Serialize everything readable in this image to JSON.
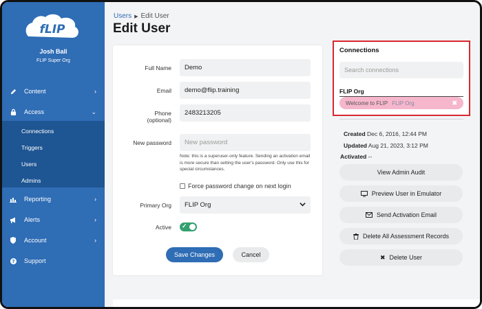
{
  "sidebar": {
    "user_name": "Josh Ball",
    "user_org": "FLIP Super Org",
    "items": [
      {
        "label": "Content",
        "icon": "pencil-icon"
      },
      {
        "label": "Access",
        "icon": "lock-icon"
      },
      {
        "label": "Reporting",
        "icon": "bar-chart-icon"
      },
      {
        "label": "Alerts",
        "icon": "megaphone-icon"
      },
      {
        "label": "Account",
        "icon": "shield-icon"
      },
      {
        "label": "Support",
        "icon": "help-circle-icon"
      }
    ],
    "access_submenu": [
      "Connections",
      "Triggers",
      "Users",
      "Admins"
    ]
  },
  "breadcrumb": {
    "parent": "Users",
    "current": "Edit User"
  },
  "page_title": "Edit User",
  "form": {
    "full_name_label": "Full Name",
    "full_name_value": "Demo",
    "email_label": "Email",
    "email_value": "demo@flip.training",
    "phone_label_1": "Phone",
    "phone_label_2": "(optional)",
    "phone_value": "2483213205",
    "password_label": "New password",
    "password_placeholder": "New password",
    "password_note": "Note: this is a superuser-only feature. Sending an activation email is more secure than setting the user's password. Only use this for special circumstances.",
    "force_change_label": "Force password change on next login",
    "primary_org_label": "Primary Org",
    "primary_org_value": "FLIP Org",
    "active_label": "Active",
    "active_on": true,
    "save_label": "Save Changes",
    "cancel_label": "Cancel"
  },
  "connections": {
    "title": "Connections",
    "search_placeholder": "Search connections",
    "group": "FLIP Org",
    "tag_label": "Welcome to FLIP",
    "tag_org": "FLIP Org",
    "tag_color": "#f6b6cc"
  },
  "meta": {
    "created_label": "Created",
    "created_value": "Dec 6, 2016, 12:44 PM",
    "updated_label": "Updated",
    "updated_value": "Aug 21, 2023, 3:12 PM",
    "activated_label": "Activated",
    "activated_value": "--"
  },
  "actions": {
    "view_audit": "View Admin Audit",
    "preview": "Preview User in Emulator",
    "send_activation": "Send Activation Email",
    "delete_records": "Delete All Assessment Records",
    "delete_user": "Delete User"
  },
  "colors": {
    "sidebar": "#2f6db5",
    "sidebar_submenu": "#1e5593",
    "primary": "#2f6db5",
    "highlight_border": "#d8262e",
    "toggle_on": "#33a06f"
  }
}
